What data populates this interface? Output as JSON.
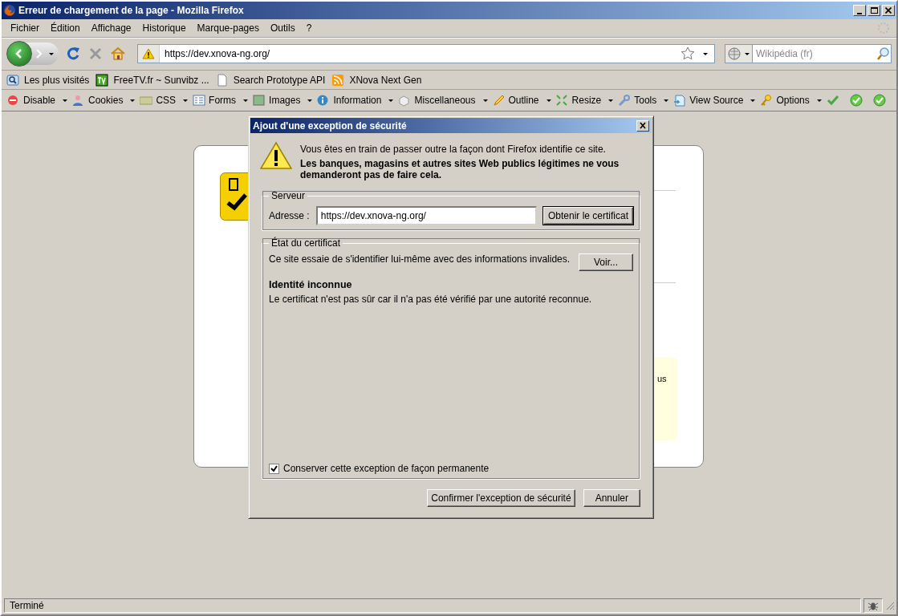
{
  "window": {
    "title": "Erreur de chargement de la page - Mozilla Firefox"
  },
  "menu": [
    {
      "label": "Fichier"
    },
    {
      "label": "Édition"
    },
    {
      "label": "Affichage"
    },
    {
      "label": "Historique"
    },
    {
      "label": "Marque-pages"
    },
    {
      "label": "Outils"
    },
    {
      "label": "?"
    }
  ],
  "navigation": {
    "url": "https://dev.xnova-ng.org/",
    "search_placeholder": "Wikipédia (fr)"
  },
  "bookmarks": [
    {
      "kind": "smart",
      "label": "Les plus visités"
    },
    {
      "kind": "tv",
      "label": "FreeTV.fr ~ Sunvibz ..."
    },
    {
      "kind": "page",
      "label": "Search Prototype API"
    },
    {
      "kind": "feed",
      "label": "XNova Next Gen"
    }
  ],
  "developer_toolbar": [
    {
      "kind": "disable",
      "label": "Disable"
    },
    {
      "kind": "cookies",
      "label": "Cookies"
    },
    {
      "kind": "css",
      "label": "CSS"
    },
    {
      "kind": "forms",
      "label": "Forms"
    },
    {
      "kind": "images",
      "label": "Images"
    },
    {
      "kind": "information",
      "label": "Information"
    },
    {
      "kind": "miscellaneous",
      "label": "Miscellaneous"
    },
    {
      "kind": "outline",
      "label": "Outline"
    },
    {
      "kind": "resize",
      "label": "Resize"
    },
    {
      "kind": "tools",
      "label": "Tools"
    },
    {
      "kind": "source",
      "label": "View Source"
    },
    {
      "kind": "options",
      "label": "Options"
    }
  ],
  "page": {
    "fragment": "us"
  },
  "dialog": {
    "title": "Ajout d'une exception de sécurité",
    "warning": "Vous êtes en train de passer outre la façon dont Firefox identifie ce site.",
    "warning_strong": "Les banques, magasins et autres sites Web publics légitimes ne vous demanderont pas de faire cela.",
    "server": {
      "legend": "Serveur",
      "label": "Adresse :",
      "value": "https://dev.xnova-ng.org/",
      "button": "Obtenir le certificat"
    },
    "certificate": {
      "legend": "État du certificat",
      "description": "Ce site essaie de s'identifier lui-même avec des informations invalides.",
      "button": "Voir...",
      "heading": "Identité inconnue",
      "detail": "Le certificat n'est pas sûr car il n'a pas été vérifié par une autorité reconnue."
    },
    "permanent": {
      "label": "Conserver cette exception de façon permanente",
      "checked": true
    },
    "buttons": [
      "Confirmer l'exception de sécurité",
      "Annuler"
    ]
  },
  "status_bar": {
    "text": "Terminé"
  }
}
